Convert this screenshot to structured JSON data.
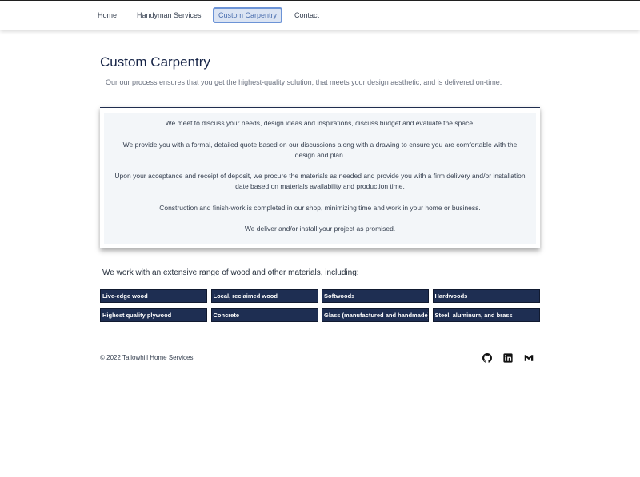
{
  "nav": {
    "items": [
      {
        "label": "Home"
      },
      {
        "label": "Handyman Services"
      },
      {
        "label": "Custom Carpentry"
      },
      {
        "label": "Contact"
      }
    ]
  },
  "header": {
    "title": "Custom Carpentry",
    "subtitle": "Our our process ensures that you get the highest-quality solution, that meets your design aesthetic, and is delivered on-time."
  },
  "process": {
    "steps": [
      "We meet to discuss your needs, design ideas and inspirations, discuss budget and evaluate the space.",
      "We provide you with a formal, detailed quote based on our discussions along with a drawing to ensure you are comfortable with the design and plan.",
      "Upon your acceptance and receipt of deposit, we procure the materials as needed and provide you with a firm delivery and/or installation date based on materials availability and production time.",
      "Construction and finish-work is completed in our shop, minimizing time and work in your home or business.",
      "We deliver and/or install your project as promised."
    ]
  },
  "materials": {
    "heading": "We work with an extensive range of wood and other materials, including:",
    "items": [
      "Live-edge wood",
      "Local, reclaimed wood",
      "Softwoods",
      "Hardwoods",
      "Highest quality plywood",
      "Concrete",
      "Glass (manufactured and handmade)",
      "Steel, aluminum, and brass"
    ]
  },
  "footer": {
    "copyright": "© 2022 Tallowhill Home Services",
    "social_icons": [
      "github-icon",
      "linkedin-icon",
      "gmail-icon"
    ]
  },
  "colors": {
    "tag_background": "#1e2e52",
    "active_nav_border": "#6c93d6",
    "title": "#162447"
  }
}
